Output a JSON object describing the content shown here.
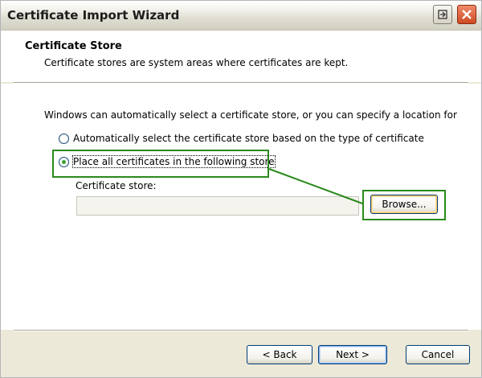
{
  "window": {
    "title": "Certificate Import Wizard"
  },
  "header": {
    "title": "Certificate Store",
    "subtitle": "Certificate stores are system areas where certificates are kept."
  },
  "body": {
    "intro": "Windows can automatically select a certificate store, or you can specify a location for",
    "options": [
      {
        "label": "Automatically select the certificate store based on the type of certificate",
        "selected": false
      },
      {
        "label": "Place all certificates in the following store",
        "selected": true
      }
    ],
    "store": {
      "label": "Certificate store:",
      "value": "",
      "browse_label": "Browse..."
    }
  },
  "footer": {
    "back_label": "< Back",
    "next_label": "Next >",
    "cancel_label": "Cancel"
  },
  "colors": {
    "annotation": "#2a8a1c",
    "radio_dot": "#39a133",
    "close_button": "#cf4a22"
  },
  "icons": {
    "help": "help-icon",
    "close": "close-icon"
  }
}
